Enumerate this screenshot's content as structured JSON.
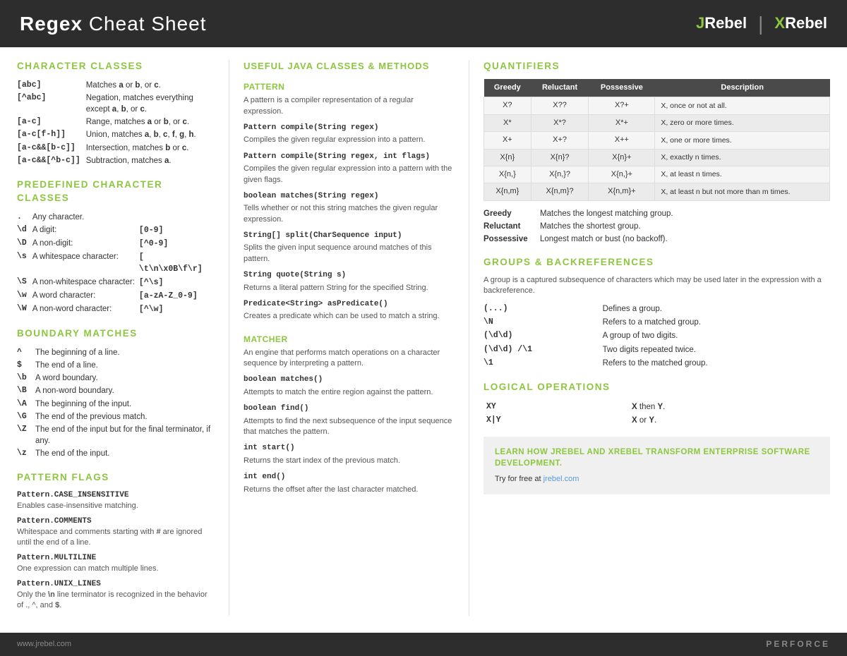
{
  "header": {
    "title_bold": "Regex",
    "title_regular": " Cheat Sheet",
    "jrebel": "JRebel",
    "xrebel": "XRebel"
  },
  "character_classes": {
    "heading": "CHARACTER CLASSES",
    "rows": [
      {
        "code": "[abc]",
        "desc": "Matches <b>a</b> or <b>b</b>, or <b>c</b>."
      },
      {
        "code": "[^abc]",
        "desc": "Negation, matches everything except <b>a</b>, <b>b</b>, or <b>c</b>."
      },
      {
        "code": "[a-c]",
        "desc": "Range, matches <b>a</b> or <b>b</b>, or <b>c</b>."
      },
      {
        "code": "[a-c[f-h]]",
        "desc": "Union, matches <b>a</b>, <b>b</b>, <b>c</b>, <b>f</b>, <b>g</b>, <b>h</b>."
      },
      {
        "code": "[a-c&&[b-c]]",
        "desc": "Intersection, matches <b>b</b> or <b>c</b>."
      },
      {
        "code": "[a-c&&[^b-c]]",
        "desc": "Subtraction, matches <b>a</b>."
      }
    ]
  },
  "predefined": {
    "heading": "PREDEFINED CHARACTER CLASSES",
    "rows": [
      {
        "code": ".",
        "label": "Any character."
      },
      {
        "code": "\\d",
        "label": "A digit:",
        "extra": "[0-9]"
      },
      {
        "code": "\\D",
        "label": "A non-digit:",
        "extra": "[^0-9]"
      },
      {
        "code": "\\s",
        "label": "A whitespace character:",
        "extra": "[ \\t\\n\\x0B\\f\\r]"
      },
      {
        "code": "\\S",
        "label": "A non-whitespace character:",
        "extra": "[^\\s]"
      },
      {
        "code": "\\w",
        "label": "A word character:",
        "extra": "[a-zA-Z_0-9]"
      },
      {
        "code": "\\W",
        "label": "A non-word character:",
        "extra": "[^\\w]"
      }
    ]
  },
  "boundary": {
    "heading": "BOUNDARY MATCHES",
    "rows": [
      {
        "code": "^",
        "desc": "The beginning of a line."
      },
      {
        "code": "$",
        "desc": "The end of a line."
      },
      {
        "code": "\\b",
        "desc": "A word boundary."
      },
      {
        "code": "\\B",
        "desc": "A non-word boundary."
      },
      {
        "code": "\\A",
        "desc": "The beginning of the input."
      },
      {
        "code": "\\G",
        "desc": "The end of the previous match."
      },
      {
        "code": "\\Z",
        "desc": "The end of the input but for the final terminator, if any."
      },
      {
        "code": "\\z",
        "desc": "The end of the input."
      }
    ]
  },
  "pattern_flags": {
    "heading": "PATTERN FLAGS",
    "items": [
      {
        "code": "Pattern.CASE_INSENSITIVE",
        "desc": "Enables case-insensitive matching."
      },
      {
        "code": "Pattern.COMMENTS",
        "desc": "Whitespace and comments starting with # are ignored until the end of a line."
      },
      {
        "code": "Pattern.MULTILINE",
        "desc": "One expression can match multiple lines."
      },
      {
        "code": "Pattern.UNIX_LINES",
        "desc": "Only the \\n line terminator is recognized in the behavior of ., ^, and $."
      }
    ]
  },
  "java_classes": {
    "heading": "USEFUL JAVA CLASSES & METHODS",
    "pattern": {
      "sub_heading": "PATTERN",
      "desc": "A pattern is a compiler representation of a regular expression.",
      "methods": [
        {
          "signature": "Pattern compile(String regex)",
          "desc": "Compiles the given regular expression into a pattern."
        },
        {
          "signature": "Pattern compile(String regex, int flags)",
          "desc": "Compiles the given regular expression into a pattern with the given flags."
        },
        {
          "signature": "boolean matches(String regex)",
          "desc": "Tells whether or not this string matches the given regular expression."
        },
        {
          "signature": "String[] split(CharSequence input)",
          "desc": "Splits the given input sequence around matches of this pattern."
        },
        {
          "signature": "String quote(String s)",
          "desc": "Returns a literal pattern String for the specified String."
        },
        {
          "signature": "Predicate<String> asPredicate()",
          "desc": "Creates a predicate which can be used to match a string."
        }
      ]
    },
    "matcher": {
      "sub_heading": "MATCHER",
      "desc": "An engine that performs match operations on a character sequence by interpreting a pattern.",
      "methods": [
        {
          "signature": "boolean matches()",
          "desc": "Attempts to match the entire region against the pattern."
        },
        {
          "signature": "boolean find()",
          "desc": "Attempts to find the next subsequence of the input sequence that matches the pattern."
        },
        {
          "signature": "int start()",
          "desc": "Returns the start index of the previous match."
        },
        {
          "signature": "int end()",
          "desc": "Returns the offset after the last character matched."
        }
      ]
    }
  },
  "quantifiers": {
    "heading": "QUANTIFIERS",
    "table_headers": [
      "Greedy",
      "Reluctant",
      "Possessive",
      "Description"
    ],
    "rows": [
      {
        "greedy": "X?",
        "reluctant": "X??",
        "possessive": "X?+",
        "desc": "X, once or not at all."
      },
      {
        "greedy": "X*",
        "reluctant": "X*?",
        "possessive": "X*+",
        "desc": "X, zero or more times."
      },
      {
        "greedy": "X+",
        "reluctant": "X+?",
        "possessive": "X++",
        "desc": "X, one or more times."
      },
      {
        "greedy": "X{n}",
        "reluctant": "X{n}?",
        "possessive": "X{n}+",
        "desc": "X, exactly n times."
      },
      {
        "greedy": "X{n,}",
        "reluctant": "X{n,}?",
        "possessive": "X{n,}+",
        "desc": "X, at least n times."
      },
      {
        "greedy": "X{n,m}",
        "reluctant": "X{n,m}?",
        "possessive": "X{n,m}+",
        "desc": "X, at least n but not more than m times."
      }
    ],
    "legend": [
      {
        "key": "Greedy",
        "desc": "Matches the longest matching group."
      },
      {
        "key": "Reluctant",
        "desc": "Matches the shortest group."
      },
      {
        "key": "Possessive",
        "desc": "Longest match or bust (no backoff)."
      }
    ]
  },
  "groups": {
    "heading": "GROUPS & BACKREFERENCES",
    "intro": "A group is a captured subsequence of characters which may be used later in the expression with a backreference.",
    "rows": [
      {
        "code": "(...)",
        "desc": "Defines a group."
      },
      {
        "code": "\\N",
        "desc": "Refers to a matched group."
      },
      {
        "code": "(\\d\\d)",
        "desc": "A group of two digits."
      },
      {
        "code": "(\\d\\d) /\\1",
        "desc": "Two digits repeated twice."
      },
      {
        "code": "\\1",
        "desc": "Refers to the matched group."
      }
    ]
  },
  "logical": {
    "heading": "LOGICAL OPERATIONS",
    "rows": [
      {
        "code": "XY",
        "desc": "<b>X</b> then <b>Y</b>."
      },
      {
        "code": "X|Y",
        "desc": "<b>X</b> or <b>Y</b>."
      }
    ]
  },
  "cta": {
    "title": "LEARN HOW JREBEL AND XREBEL TRANSFORM ENTERPRISE SOFTWARE DEVELOPMENT.",
    "sub": "Try for free at jrebel.com",
    "link": "jrebel.com"
  },
  "footer": {
    "url": "www.jrebel.com",
    "brand": "PERFORCE"
  }
}
